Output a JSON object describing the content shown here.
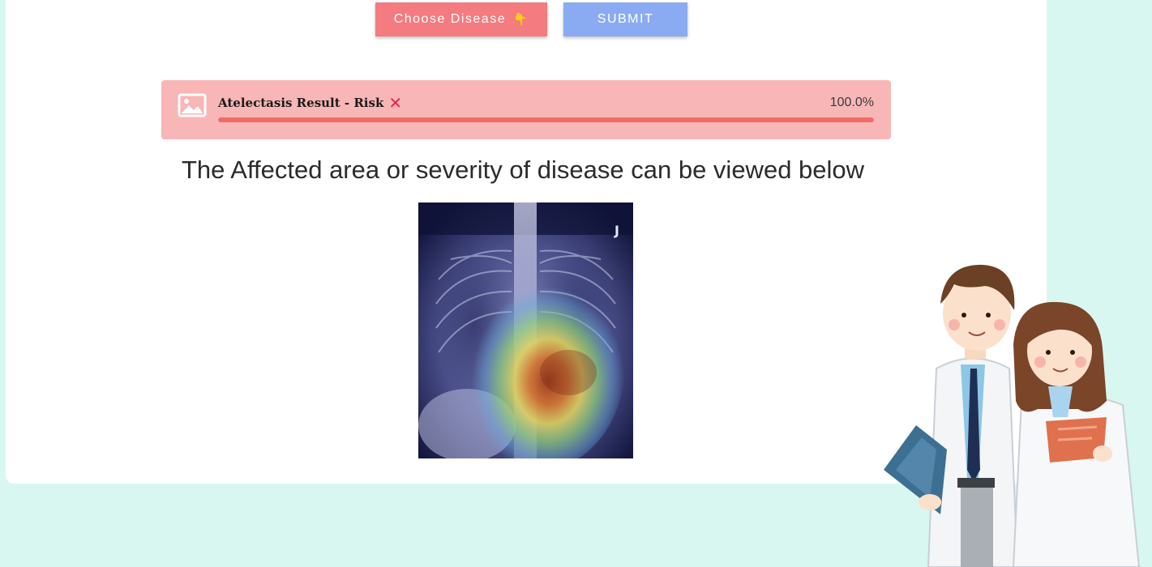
{
  "toolbar": {
    "choose_label": "Choose Disease",
    "choose_emoji": "👇",
    "submit_label": "SUBMIT"
  },
  "result": {
    "title": "Atelectasis Result - Risk",
    "status_icon": "x-icon",
    "status_color": "#e8234a",
    "percent_text": "100.0%",
    "progress": 1.0
  },
  "headline": "The Affected area or severity of disease can be viewed below",
  "xray": {
    "icon": "chest-xray-heatmap-image",
    "marker": "J"
  },
  "colors": {
    "background": "#d9f7f1",
    "card": "#ffffff",
    "choose_button": "#f47b80",
    "submit_button": "#8aabf2",
    "result_panel": "#f8b6b6",
    "progress_fill": "#ee6d66"
  }
}
